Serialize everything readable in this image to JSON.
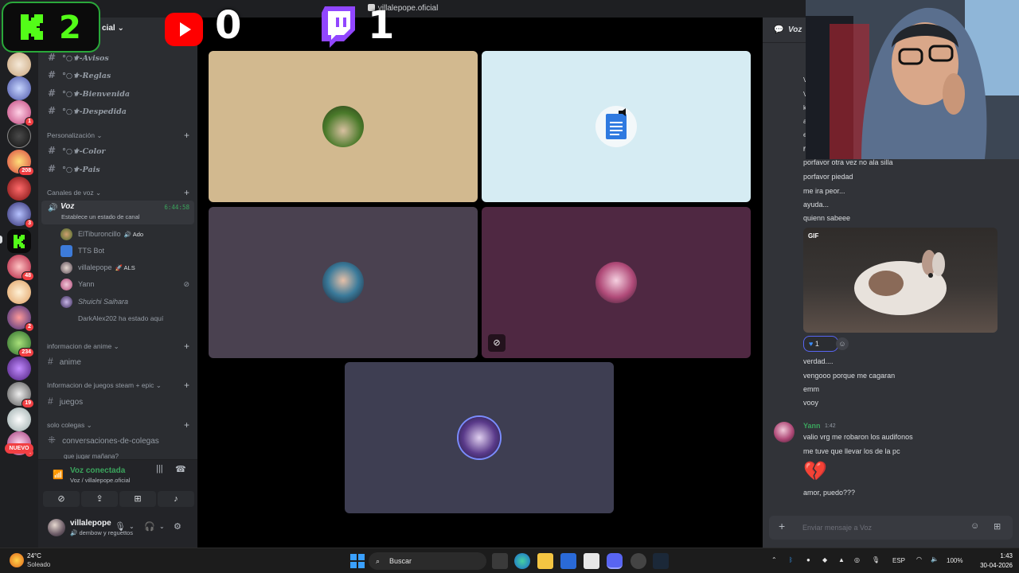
{
  "window": {
    "title": "villalepope.oficial"
  },
  "overlay": {
    "kick_count": "2",
    "youtube_count": "0",
    "twitch_count": "1"
  },
  "server": {
    "name_fragment": "cial"
  },
  "rail": {
    "badges": [
      "1",
      "208",
      "3",
      "48",
      "2",
      "234",
      "19",
      "2"
    ],
    "new_label": "NUEVO"
  },
  "sidebar": {
    "top_channels": [
      "°○⚜-Avisos",
      "°○⚜-Reglas",
      "°○⚜-Bienvenida",
      "°○⚜-Despedida"
    ],
    "personalizacion": {
      "label": "Personalización",
      "channels": [
        "°○⚜-Color",
        "°○⚜-Pais"
      ]
    },
    "voz_category": "Canales de voz",
    "voz_channel": {
      "name": "Voz",
      "status": "Establece un estado de canal",
      "time": "6:44:58"
    },
    "voice_users": [
      {
        "name": "ElTiburoncillo",
        "tag": "Ado"
      },
      {
        "name": "TTS Bot",
        "tag": ""
      },
      {
        "name": "villalepope",
        "tag": "ALS"
      },
      {
        "name": "Yann",
        "tag": ""
      },
      {
        "name": "Shuichi Saihara",
        "tag": ""
      },
      {
        "name": "DarkAlex202 ha estado aquí",
        "tag": ""
      }
    ],
    "anime_category": "informacion de anime",
    "anime_channel": "anime",
    "juegos_category": "Informacion de juegos steam + epic",
    "juegos_channel": "juegos",
    "colegas_category": "solo colegas",
    "colegas_channel": "conversaciones-de-colegas",
    "colegas_sub": "que jugar mañana?"
  },
  "voice_panel": {
    "title": "Voz conectada",
    "subtitle": "Voz / villalepope.oficial"
  },
  "user_panel": {
    "name": "villalepope",
    "status": "dembow y reguettos"
  },
  "chat": {
    "channel": "Voz",
    "left_letters": [
      "V",
      "V",
      "k",
      "a",
      "e",
      "n",
      "r"
    ],
    "messages_a": [
      "porfavor otra vez no ala silla",
      "porfavor piedad",
      "me ira peor...",
      "ayuda...",
      "quienn sabeee"
    ],
    "gif_label": "GIF",
    "reaction_count": "1",
    "messages_b": [
      "verdad....",
      "vengooo porque me cagaran",
      "emm",
      "vooy"
    ],
    "yann": {
      "name": "Yann",
      "time": "1:42",
      "messages": [
        "valio vrg me robaron los audifonos",
        "me tuve que llevar los de la pc"
      ]
    },
    "last_message": "amor, puedo???",
    "composer_placeholder": "Enviar mensaje a Voz"
  },
  "taskbar": {
    "weather_temp": "24°C",
    "weather_desc": "Soleado",
    "search": "Buscar",
    "lang": "ESP",
    "battery": "100%",
    "time": "1:43",
    "date": "30-04-2026"
  },
  "colors": {
    "discord_green": "#3ba55d",
    "sidebar_bg": "#2b2d31",
    "chat_bg": "#313338",
    "kick_green": "#53fc18",
    "youtube_red": "#ff0000",
    "twitch_purple": "#9146ff"
  }
}
